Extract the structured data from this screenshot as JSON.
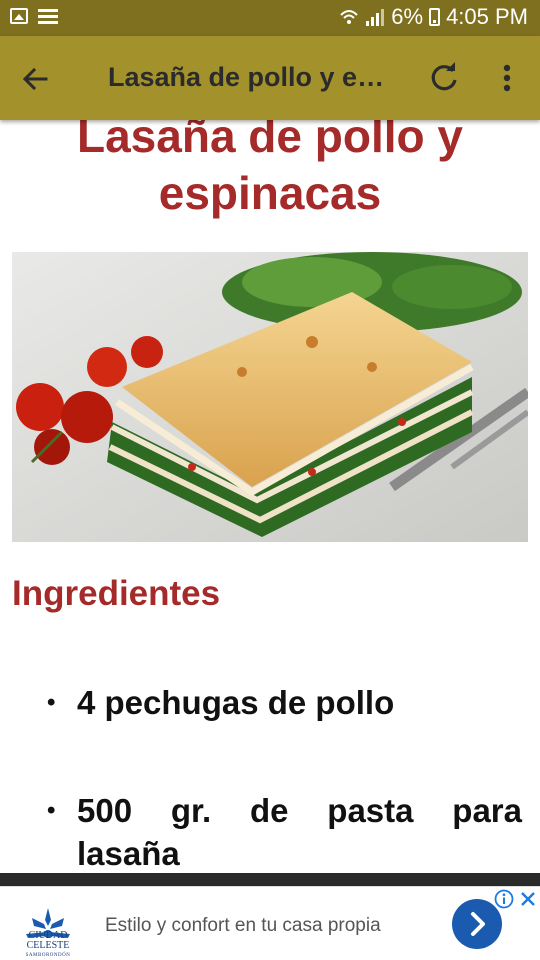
{
  "status_bar": {
    "battery": "6%",
    "time": "4:05 PM",
    "icons": [
      "image-icon",
      "list-icon",
      "wifi-icon",
      "signal-icon",
      "battery-charging-icon"
    ]
  },
  "app_bar": {
    "title": "Lasaña de pollo y e…",
    "icons": [
      "back-arrow-icon",
      "refresh-icon",
      "more-vert-icon"
    ],
    "color": "#a3922c"
  },
  "recipe": {
    "title_line1": "Lasaña de pollo y",
    "title_line2": "espinacas",
    "title_color": "#a52a2a",
    "section_heading": "Ingredientes",
    "ingredients": [
      "4 pechugas de pollo",
      "500 gr. de pasta para lasaña"
    ],
    "ingredient2_words": [
      "500",
      "gr.",
      "de",
      "pasta",
      "para"
    ],
    "ingredient2_last": "lasaña"
  },
  "ad": {
    "logo_line1": "CIUDAD",
    "logo_line2": "CELESTE",
    "logo_line3": "SAMBORONDÓN",
    "text": "Estilo y confort en tu casa propia",
    "button_color": "#1a5bb0",
    "icons": [
      "ad-info-icon",
      "ad-close-icon",
      "chevron-right-icon"
    ]
  }
}
